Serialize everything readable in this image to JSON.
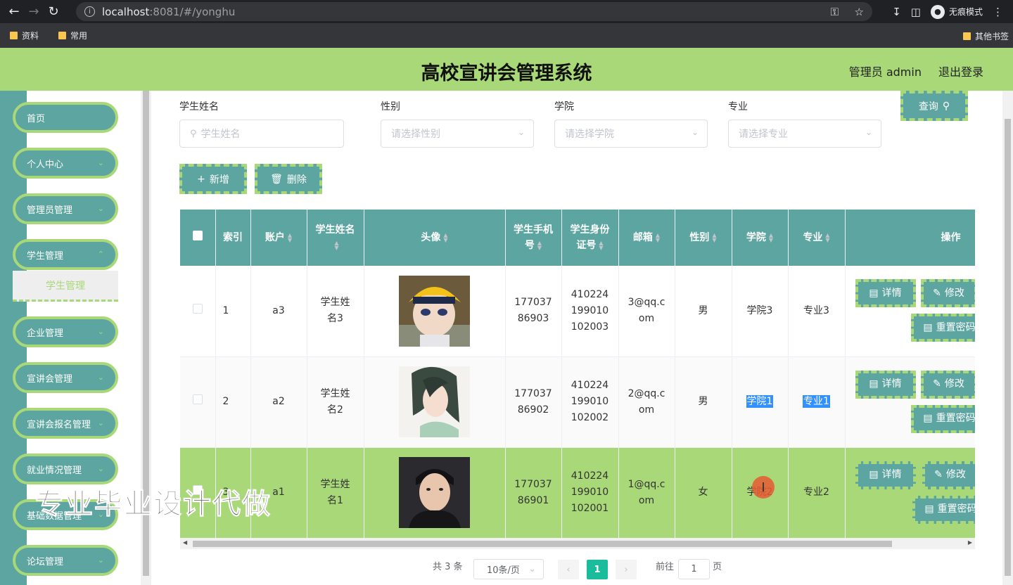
{
  "browser": {
    "url_host": "localhost",
    "url_path": ":8081/#/yonghu",
    "incognito_label": "无痕模式",
    "bookmarks": [
      "资料",
      "常用"
    ],
    "other_bookmarks": "其他书签"
  },
  "header": {
    "title": "高校宣讲会管理系统",
    "user": "管理员 admin",
    "logout": "退出登录"
  },
  "sidebar": {
    "items": [
      {
        "label": "首页"
      },
      {
        "label": "个人中心"
      },
      {
        "label": "管理员管理"
      },
      {
        "label": "学生管理"
      },
      {
        "label": "企业管理"
      },
      {
        "label": "宣讲会管理"
      },
      {
        "label": "宣讲会报名管理"
      },
      {
        "label": "就业情况管理"
      },
      {
        "label": "基础数据管理"
      },
      {
        "label": "论坛管理"
      }
    ],
    "submenu_active": "学生管理"
  },
  "filters": {
    "name_label": "学生姓名",
    "name_placeholder": "学生姓名",
    "gender_label": "性别",
    "gender_placeholder": "请选择性别",
    "college_label": "学院",
    "college_placeholder": "请选择学院",
    "major_label": "专业",
    "major_placeholder": "请选择专业",
    "query_button": "查询"
  },
  "actions": {
    "add": "新增",
    "delete": "删除"
  },
  "table": {
    "headers": [
      "索引",
      "账户",
      "学生姓名",
      "头像",
      "学生手机号",
      "学生身份证号",
      "邮箱",
      "性别",
      "学院",
      "专业",
      "操作"
    ],
    "rows": [
      {
        "index": "1",
        "account": "a3",
        "name": "学生姓名3",
        "phone": "17703786903",
        "idno": "410224199010102003",
        "email": "3@qq.com",
        "gender": "男",
        "college": "学院3",
        "major": "专业3"
      },
      {
        "index": "2",
        "account": "a2",
        "name": "学生姓名2",
        "phone": "17703786902",
        "idno": "410224199010102002",
        "email": "2@qq.com",
        "gender": "男",
        "college": "学院1",
        "major": "专业1"
      },
      {
        "index": "3",
        "account": "a1",
        "name": "学生姓名1",
        "phone": "17703786901",
        "idno": "410224199010102001",
        "email": "1@qq.com",
        "gender": "女",
        "college": "学院2",
        "major": "专业2"
      }
    ],
    "detail_btn": "详情",
    "edit_btn": "修改",
    "reset_btn": "重置密码"
  },
  "pagination": {
    "total": "共 3 条",
    "page_size": "10条/页",
    "current": "1",
    "goto_label": "前往",
    "goto_value": "1",
    "page_unit": "页"
  },
  "watermark": "专业毕业设计代做"
}
